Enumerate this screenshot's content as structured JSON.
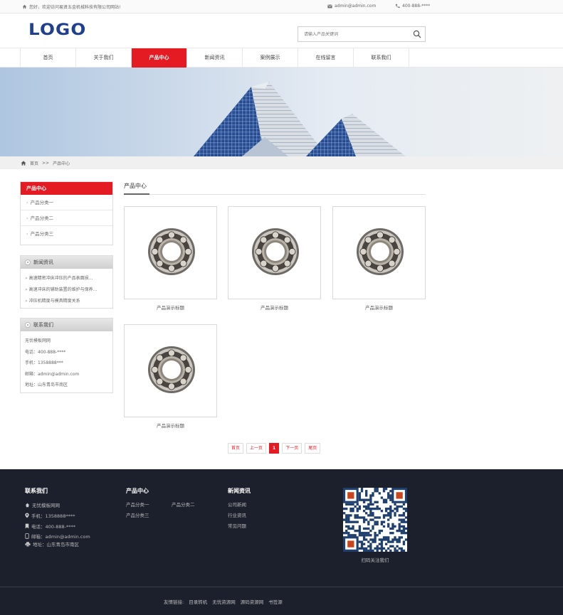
{
  "topbar": {
    "welcome": "您好，欢迎访问易贤五金机械科技有限公司网站!",
    "email": "admin@admin.com",
    "phone": "400-888-****"
  },
  "header": {
    "logo": "LOGO",
    "search_placeholder": "请输入产品关键词"
  },
  "nav": {
    "items": [
      "首页",
      "关于我们",
      "产品中心",
      "新闻资讯",
      "案例展示",
      "在线留言",
      "联系我们"
    ],
    "active_index": 2
  },
  "breadcrumb": {
    "home": "首页",
    "sep": ">>",
    "current": "产品中心"
  },
  "sidebar": {
    "products_title": "产品中心",
    "products": [
      "产品分类一",
      "产品分类二",
      "产品分类三"
    ],
    "news_title": "新闻资讯",
    "news": [
      "高速精密冲床冲压的产品表面损...",
      "高速冲床的辅助装置的维护与保养...",
      "冲压机精度与模具精度关系"
    ],
    "contact_title": "联系我们",
    "contact": {
      "company": "无忧模板网网",
      "tel": "电话：400-888-****",
      "mobile": "手机：1358888***",
      "email": "邮箱：admin@admin.com",
      "address": "地址：山东青岛市南区"
    }
  },
  "main": {
    "title": "产品中心",
    "products": [
      {
        "caption": "产品演示标题"
      },
      {
        "caption": "产品演示标题"
      },
      {
        "caption": "产品演示标题"
      },
      {
        "caption": "产品演示标题"
      }
    ]
  },
  "pager": {
    "first": "首页",
    "prev": "上一页",
    "current": "1",
    "next": "下一页",
    "last": "尾页"
  },
  "footer": {
    "contact_title": "联系我们",
    "contact": {
      "company": "无忧模板网网",
      "mobile": "手机：1358888****",
      "tel": "电话：400-888-****",
      "email": "邮箱：admin@admin.com",
      "address": "地址：山东青岛市南区"
    },
    "products_title": "产品中心",
    "products": [
      "产品分类一",
      "产品分类二",
      "产品分类三"
    ],
    "news_title": "新闻资讯",
    "news": [
      "公司新闻",
      "行业资讯",
      "常见问题"
    ],
    "qr_caption": "扫码关注我们",
    "links_label": "友情链接:",
    "links": [
      "目录转机",
      "无忧资源网",
      "源码资源网",
      "书签源"
    ]
  }
}
